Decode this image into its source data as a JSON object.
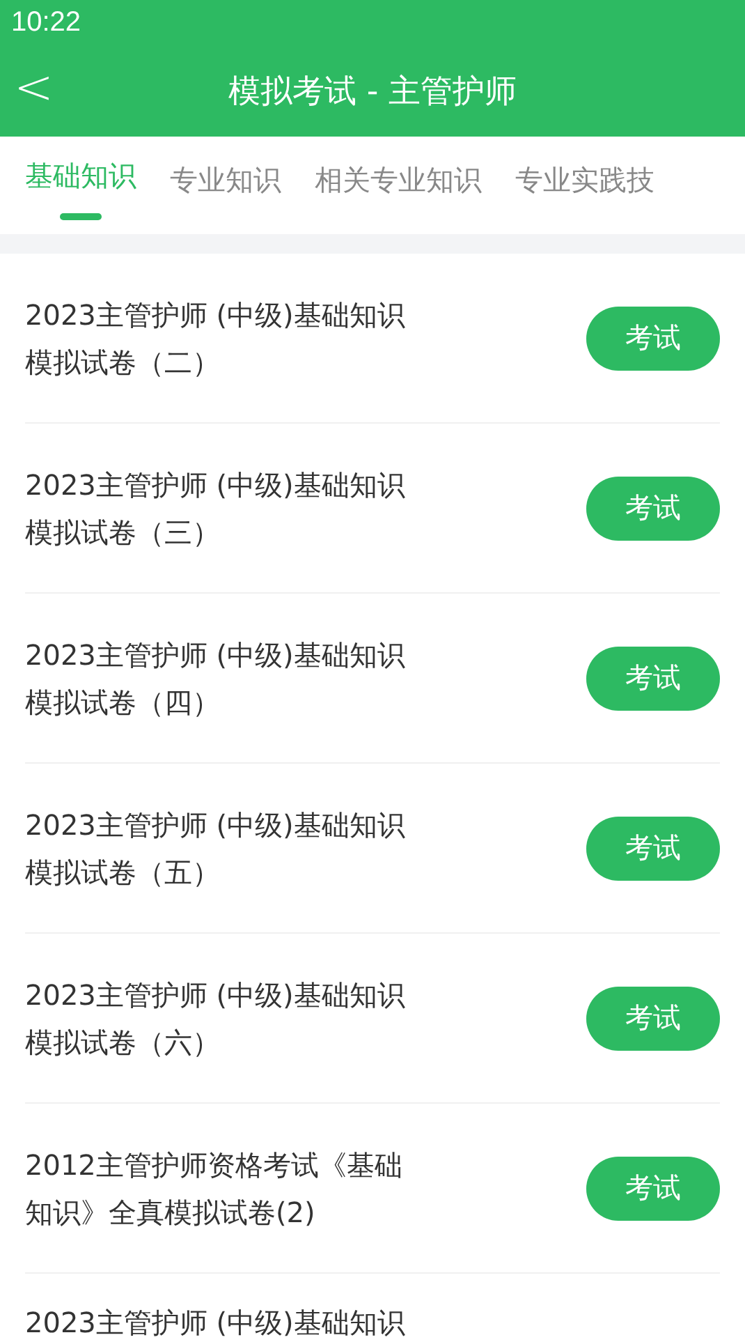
{
  "status_bar": {
    "time": "10:22"
  },
  "header": {
    "back": "<",
    "title": "模拟考试 - 主管护师"
  },
  "tabs": [
    {
      "label": "基础知识",
      "selected": true
    },
    {
      "label": "专业知识",
      "selected": false
    },
    {
      "label": "相关专业知识",
      "selected": false
    },
    {
      "label": "专业实践技",
      "selected": false
    }
  ],
  "papers": [
    {
      "title": "2023主管护师 (中级)基础知识模拟试卷（二）",
      "button": "考试"
    },
    {
      "title": "2023主管护师 (中级)基础知识模拟试卷（三）",
      "button": "考试"
    },
    {
      "title": "2023主管护师 (中级)基础知识模拟试卷（四）",
      "button": "考试"
    },
    {
      "title": "2023主管护师 (中级)基础知识模拟试卷（五）",
      "button": "考试"
    },
    {
      "title": "2023主管护师 (中级)基础知识模拟试卷（六）",
      "button": "考试"
    },
    {
      "title": "2012主管护师资格考试《基础知识》全真模拟试卷(2)",
      "button": "考试"
    },
    {
      "title": "2023主管护师 (中级)基础知识"
    }
  ]
}
